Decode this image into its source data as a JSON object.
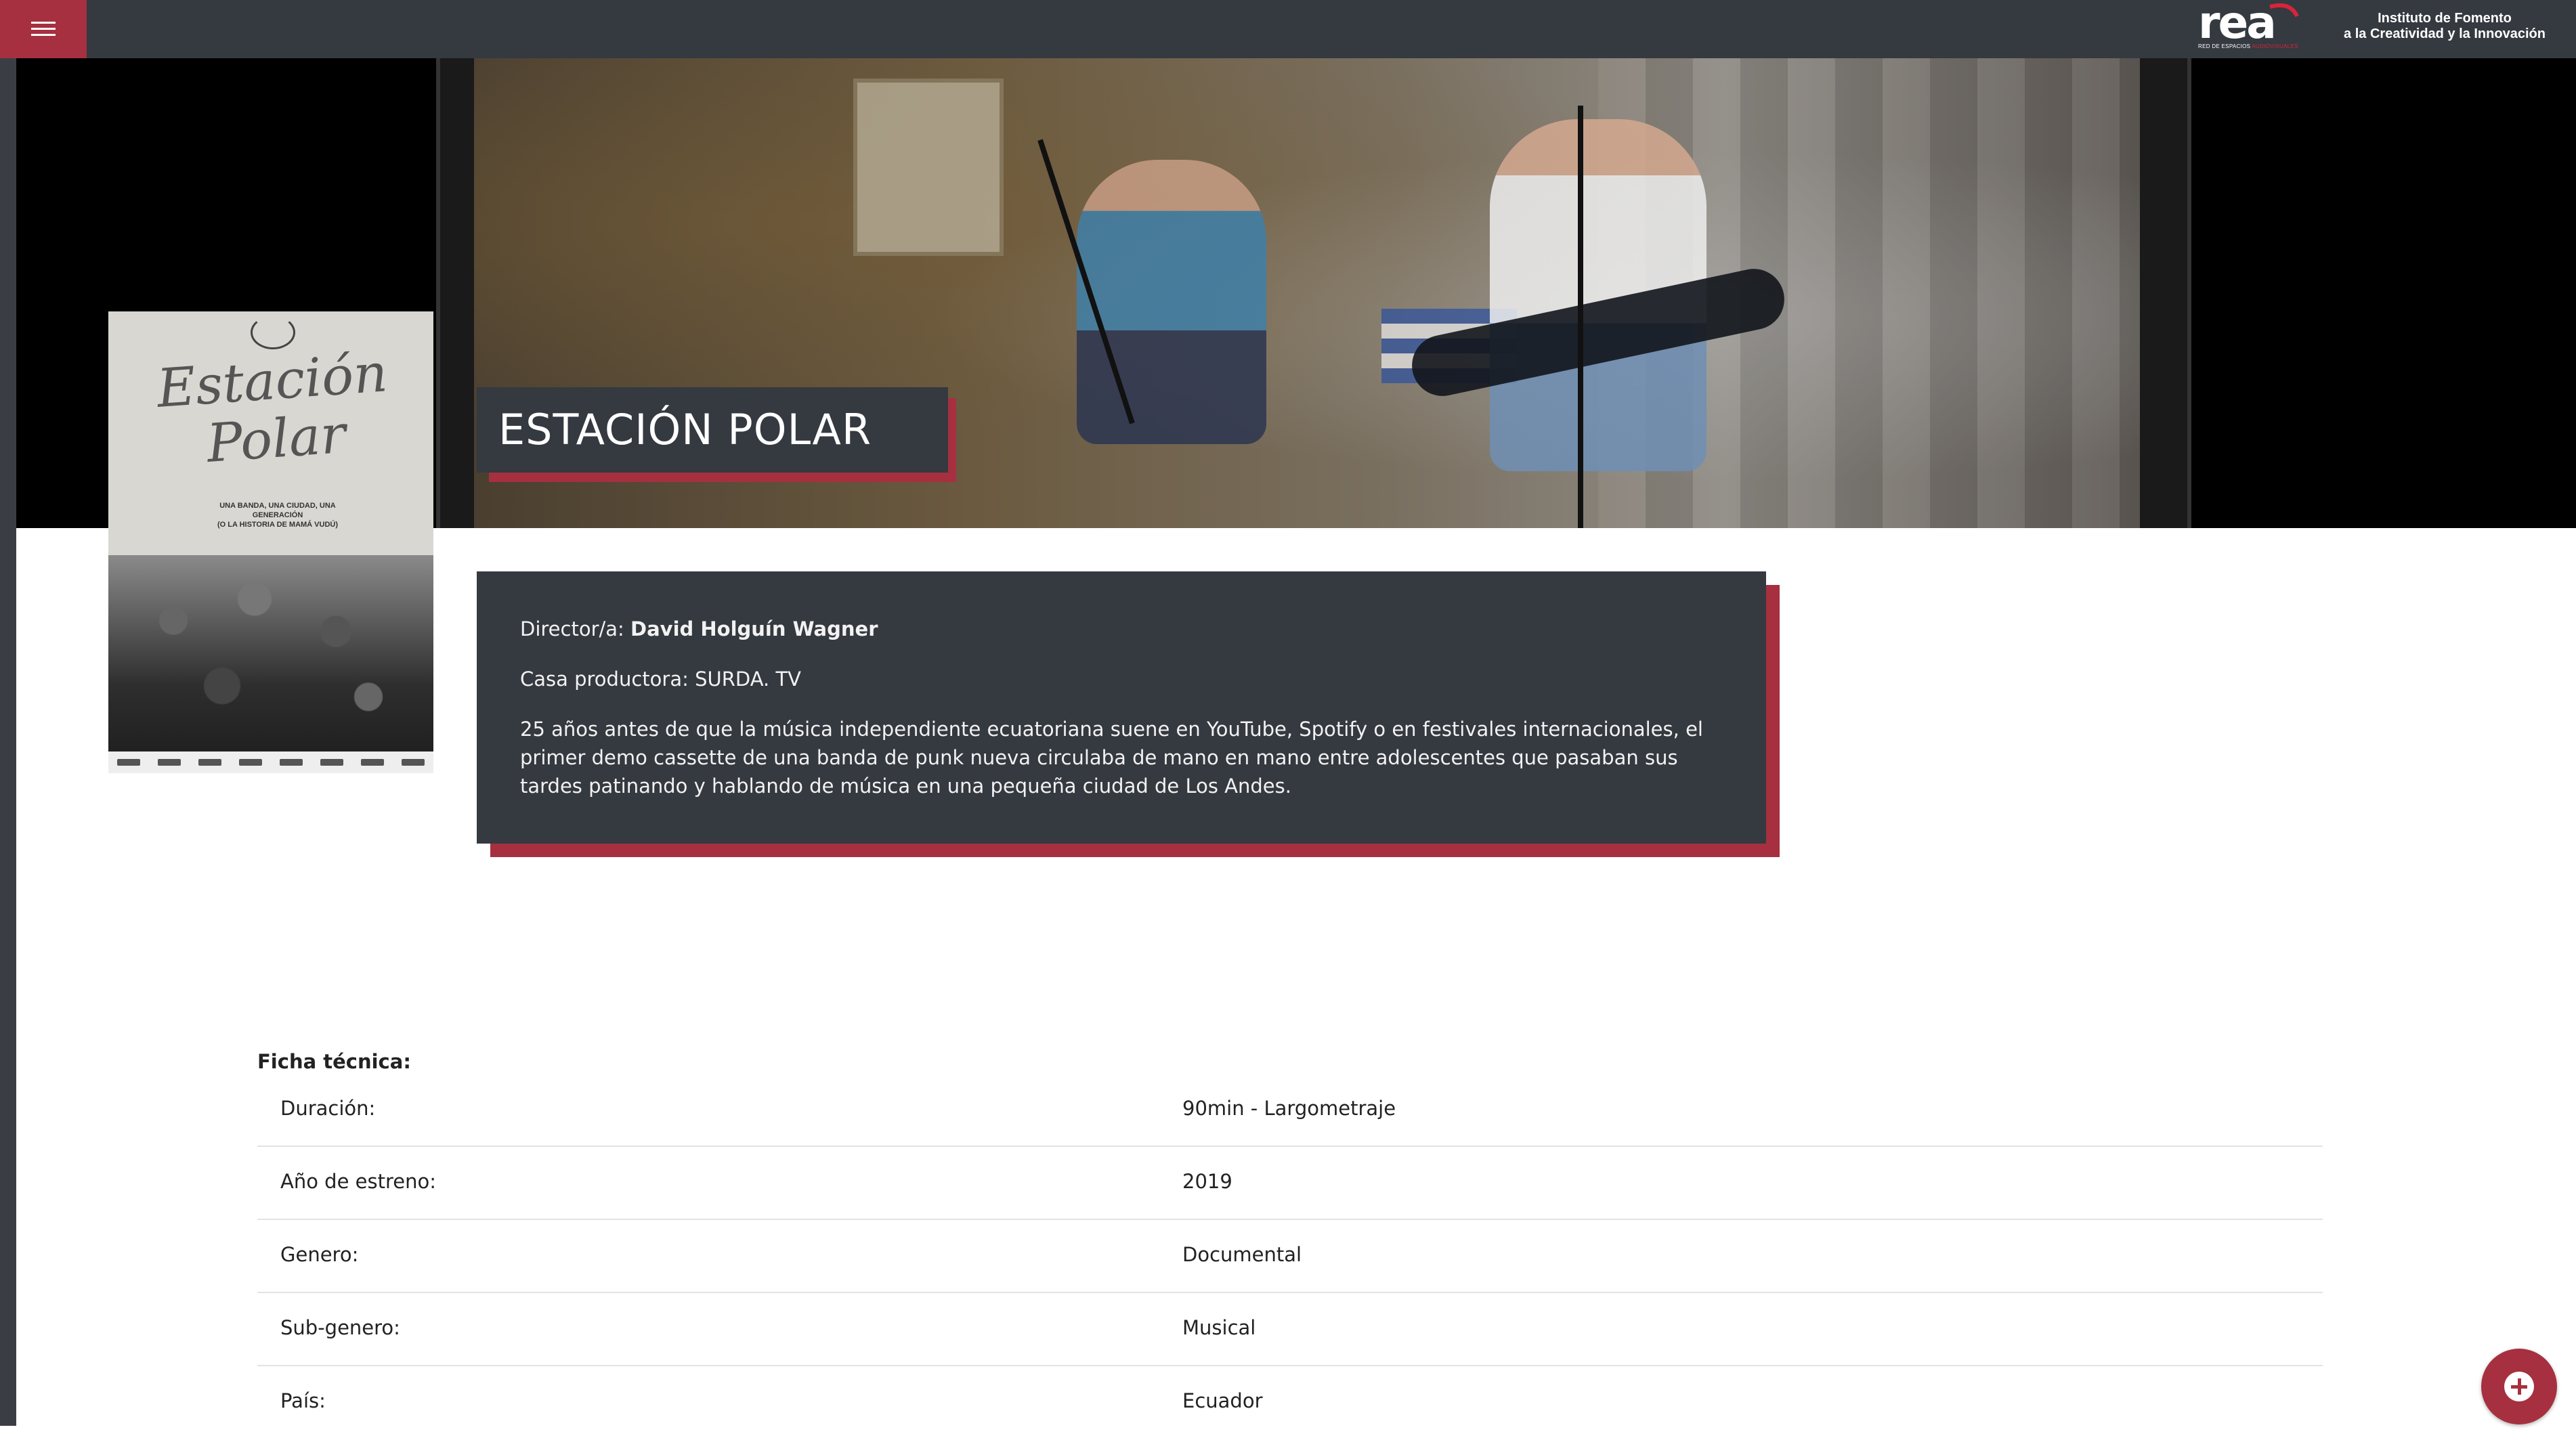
{
  "header": {
    "menu_icon": "hamburger-menu-icon",
    "logo_text": "rea",
    "logo_subtitle_prefix": "RED DE ESPACIOS",
    "logo_subtitle_accent": "AUDIOVISUALES",
    "institute_line1": "Instituto de Fomento",
    "institute_line2": "a la Creatividad y la Innovación",
    "accent_color": "#a6303f",
    "bar_color": "#353940"
  },
  "hero": {
    "title": "ESTACIÓN POLAR"
  },
  "poster": {
    "title_line1": "Estación",
    "title_line2": "Polar",
    "tagline_line1": "UNA BANDA, UNA CIUDAD, UNA GENERACIÓN",
    "tagline_line2": "(O LA HISTORIA DE MAMÁ VUDÚ)"
  },
  "info": {
    "director_label": "Director/a:",
    "director_value": "David Holguín Wagner",
    "producer_label": "Casa productora:",
    "producer_value": "SURDA. TV",
    "synopsis": "25 años antes de que la música independiente ecuatoriana suene en YouTube, Spotify o en festivales internacionales, el primer demo cassette de una banda de punk nueva circulaba de mano en mano entre adolescentes que pasaban sus tardes patinando y hablando de música en una pequeña ciudad de Los Andes."
  },
  "ficha": {
    "heading": "Ficha técnica:",
    "rows": [
      {
        "label": "Duración:",
        "value": "90min - Largometraje"
      },
      {
        "label": "Año de estreno:",
        "value": "2019"
      },
      {
        "label": "Genero:",
        "value": "Documental"
      },
      {
        "label": "Sub-genero:",
        "value": "Musical"
      },
      {
        "label": "País:",
        "value": "Ecuador"
      }
    ]
  },
  "fab": {
    "icon": "plus-circle-icon"
  }
}
